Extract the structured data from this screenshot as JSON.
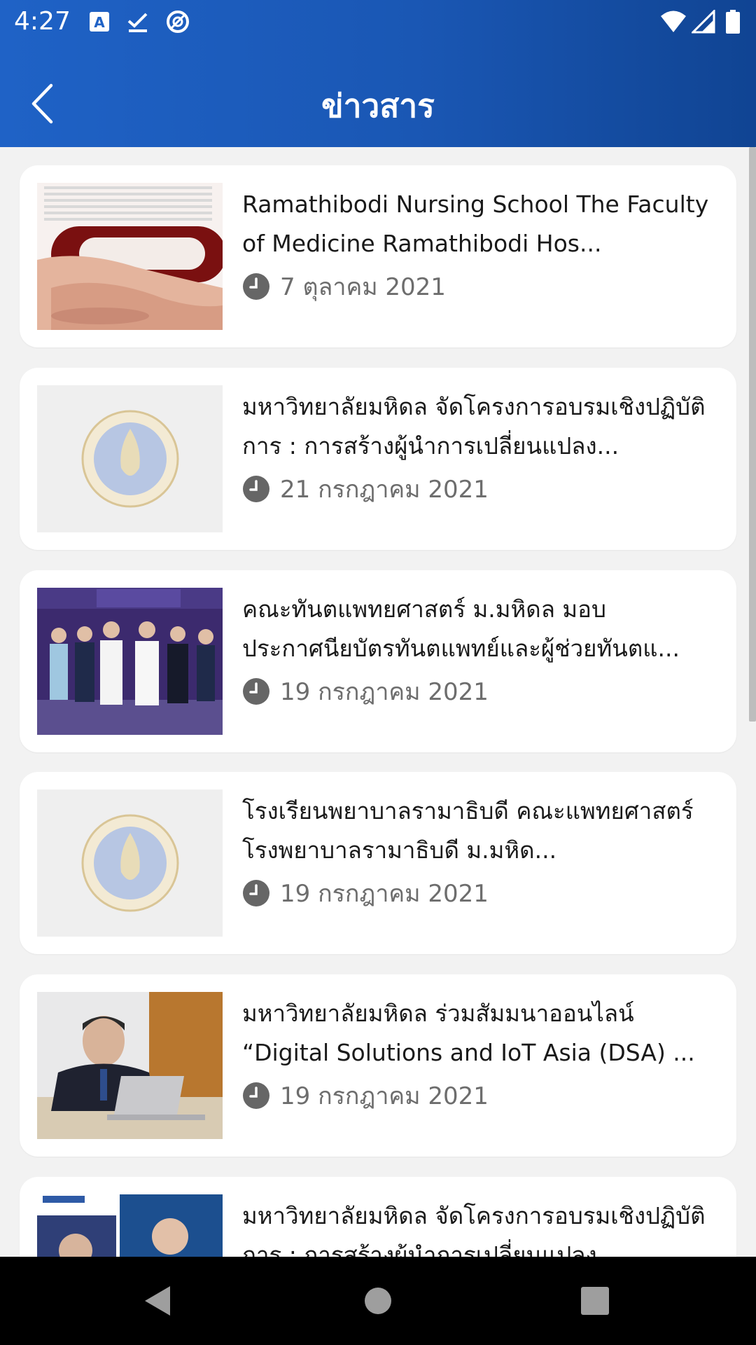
{
  "status_bar": {
    "time": "4:27",
    "icons": [
      "a-letter-icon",
      "checkmark-icon",
      "at-sign-icon",
      "wifi-icon",
      "signal-icon",
      "battery-icon"
    ]
  },
  "app_bar": {
    "title": "ข่าวสาร",
    "back_icon": "back-arrow-icon"
  },
  "colors": {
    "app_bar_start": "#1f62c6",
    "app_bar_end": "#104493",
    "background": "#f2f2f2",
    "card": "#ffffff",
    "date_text": "#6d6d6d"
  },
  "news": [
    {
      "title": "Ramathibodi Nursing School The Faculty of Medicine Ramathibodi Hos...",
      "date": "7 ตุลาคม 2021",
      "thumbnail": "hands-photo"
    },
    {
      "title": "มหาวิทยาลัยมหิดล จัดโครงการอบรมเชิงปฏิบัติการ : การสร้างผู้นำการเปลี่ยนแปลง...",
      "date": "21 กรกฎาคม 2021",
      "thumbnail": "mahidol-seal-placeholder"
    },
    {
      "title": "คณะทันตแพทยศาสตร์ ม.มหิดล มอบประกาศนียบัตรทันตแพทย์และผู้ช่วยทันตแ...",
      "date": "19 กรกฎาคม 2021",
      "thumbnail": "group-photo"
    },
    {
      "title": "โรงเรียนพยาบาลรามาธิบดี คณะแพทยศาสตร์โรงพยาบาลรามาธิบดี ม.มหิด...",
      "date": "19 กรกฎาคม 2021",
      "thumbnail": "mahidol-seal-placeholder"
    },
    {
      "title": "มหาวิทยาลัยมหิดล ร่วมสัมมนาออนไลน์ “Digital Solutions and IoT Asia (DSA) ...",
      "date": "19 กรกฎาคม 2021",
      "thumbnail": "laptop-speaker-photo"
    },
    {
      "title": "มหาวิทยาลัยมหิดล จัดโครงการอบรมเชิงปฏิบัติการ : การสร้างผู้นำการเปลี่ยนแปลง...",
      "date": "",
      "thumbnail": "poster-photo"
    }
  ],
  "nav_bar": {
    "icons": [
      "nav-back-icon",
      "nav-home-icon",
      "nav-recents-icon"
    ]
  }
}
